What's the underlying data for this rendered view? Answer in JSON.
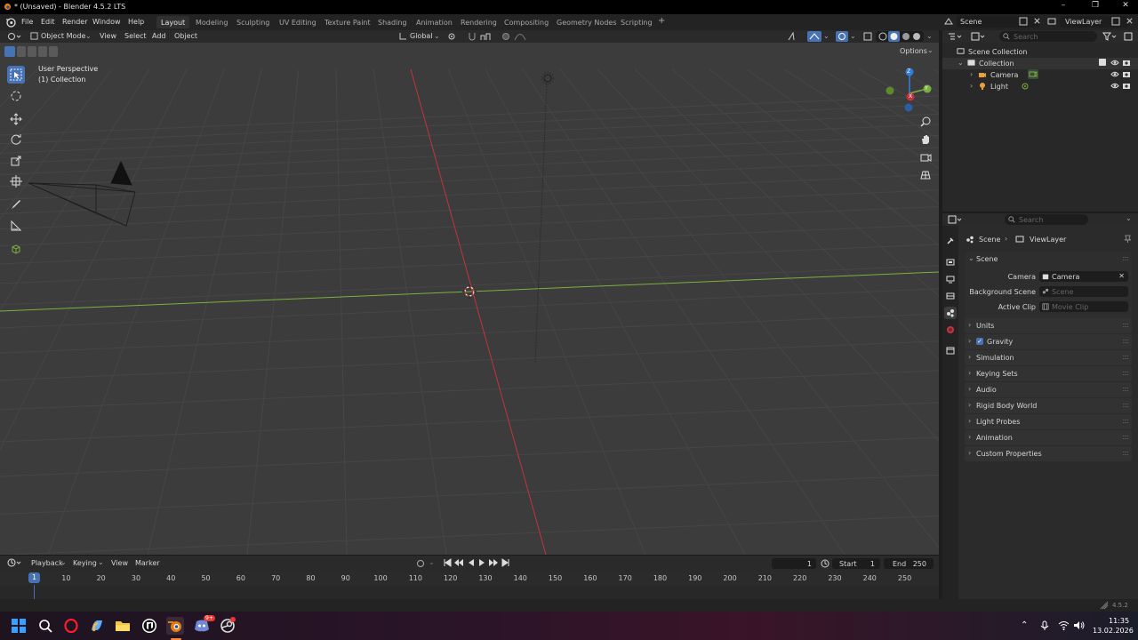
{
  "window": {
    "title": "* (Unsaved) - Blender 4.5.2 LTS",
    "minimize": "–",
    "maximize": "❐",
    "close": "✕"
  },
  "menu": {
    "items": [
      "File",
      "Edit",
      "Render",
      "Window",
      "Help"
    ]
  },
  "workspaces": [
    "Layout",
    "Modeling",
    "Sculpting",
    "UV Editing",
    "Texture Paint",
    "Shading",
    "Animation",
    "Rendering",
    "Compositing",
    "Geometry Nodes",
    "Scripting"
  ],
  "workspace_add": "+",
  "scene_selector": {
    "scene": "Scene",
    "view_layer": "ViewLayer"
  },
  "viewport_header": {
    "mode": "Object Mode",
    "menus": [
      "View",
      "Select",
      "Add",
      "Object"
    ],
    "transform_orientation": "Global",
    "options": "Options"
  },
  "viewport": {
    "perspective": "User Perspective",
    "collection": "(1) Collection",
    "gizmo": {
      "x": "X",
      "y": "Y",
      "z": "Z"
    }
  },
  "toolbar": [
    "select-box",
    "cursor",
    "move",
    "rotate",
    "scale",
    "transform",
    "annotate",
    "measure",
    "add-cube"
  ],
  "outliner": {
    "search_placeholder": "Search",
    "root": "Scene Collection",
    "collection": "Collection",
    "items": [
      "Camera",
      "Light"
    ]
  },
  "properties": {
    "search_placeholder": "Search",
    "breadcrumb": {
      "scene": "Scene",
      "view_layer": "ViewLayer"
    },
    "section": "Scene",
    "camera_label": "Camera",
    "camera_value": "Camera",
    "background_scene_label": "Background Scene",
    "background_scene_placeholder": "Scene",
    "active_clip_label": "Active Clip",
    "active_clip_placeholder": "Movie Clip",
    "panels": [
      "Units",
      "Gravity",
      "Simulation",
      "Keying Sets",
      "Audio",
      "Rigid Body World",
      "Light Probes",
      "Animation",
      "Custom Properties"
    ]
  },
  "timeline": {
    "menus": [
      "Playback",
      "Keying",
      "View",
      "Marker"
    ],
    "current_frame": "1",
    "start_label": "Start",
    "start": "1",
    "end_label": "End",
    "end": "250",
    "playhead_frame": "1",
    "ticks": [
      "10",
      "20",
      "30",
      "40",
      "50",
      "60",
      "70",
      "80",
      "90",
      "100",
      "110",
      "120",
      "130",
      "140",
      "150",
      "160",
      "170",
      "180",
      "190",
      "200",
      "210",
      "220",
      "230",
      "240",
      "250"
    ]
  },
  "status": {
    "version": "4.5.2"
  },
  "taskbar": {
    "time": "11:35",
    "date": "13.02.2026",
    "badge": "9+",
    "apps": [
      "windows-start",
      "search",
      "opera",
      "copilot",
      "file-explorer",
      "unreal",
      "blender",
      "discord",
      "steam"
    ]
  },
  "colors": {
    "accent": "#4772b3",
    "x_axis": "#c5333d",
    "y_axis": "#7ab040",
    "z_axis": "#2f7fd8",
    "viewport_bg": "#3c3c3c"
  }
}
